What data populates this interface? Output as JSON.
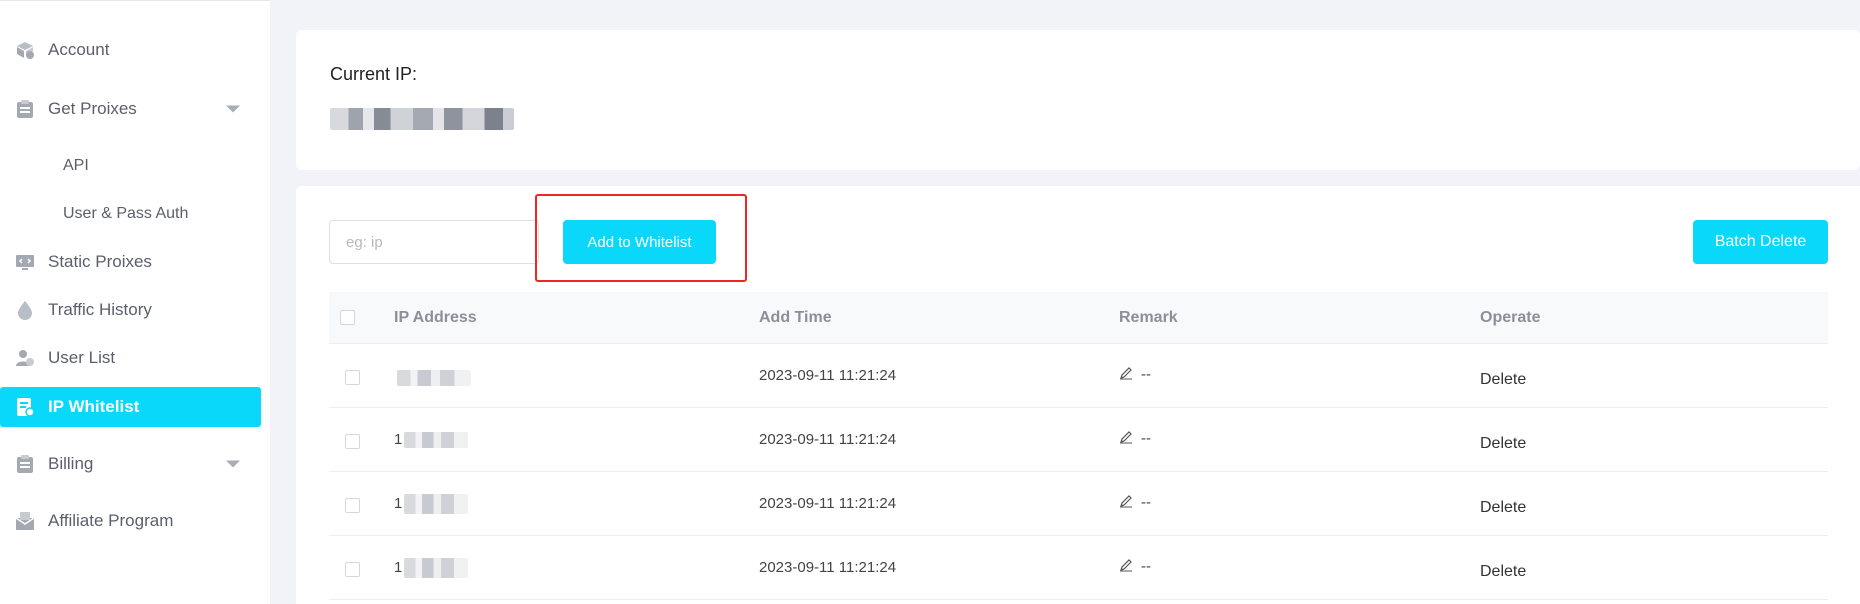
{
  "sidebar": {
    "items": [
      {
        "label": "Account",
        "icon": "account-icon"
      },
      {
        "label": "Get Proixes",
        "icon": "clipboard-icon",
        "expandable": true
      },
      {
        "label": "API",
        "sub": true
      },
      {
        "label": "User & Pass Auth",
        "sub": true
      },
      {
        "label": "Static Proixes",
        "icon": "monitor-icon"
      },
      {
        "label": "Traffic History",
        "icon": "drop-icon"
      },
      {
        "label": "User List",
        "icon": "users-icon"
      },
      {
        "label": "IP Whitelist",
        "icon": "whitelist-icon",
        "active": true
      },
      {
        "label": "Billing",
        "icon": "clipboard-icon",
        "expandable": true
      },
      {
        "label": "Affiliate Program",
        "icon": "mail-icon"
      }
    ],
    "accent_color": "#0ad8fb"
  },
  "current_ip": {
    "label": "Current IP:"
  },
  "toolbar": {
    "search_placeholder": "eg: ip",
    "add_label": "Add to Whitelist",
    "batch_delete_label": "Batch Delete"
  },
  "table": {
    "headers": {
      "ip": "IP Address",
      "time": "Add Time",
      "remark": "Remark",
      "operate": "Operate"
    },
    "rows": [
      {
        "ip_prefix": "",
        "time": "2023-09-11 11:21:24",
        "remark": "--",
        "action": "Delete"
      },
      {
        "ip_prefix": "1",
        "time": "2023-09-11 11:21:24",
        "remark": "--",
        "action": "Delete"
      },
      {
        "ip_prefix": "1",
        "time": "2023-09-11 11:21:24",
        "remark": "--",
        "action": "Delete"
      },
      {
        "ip_prefix": "1",
        "time": "2023-09-11 11:21:24",
        "remark": "--",
        "action": "Delete"
      }
    ]
  }
}
